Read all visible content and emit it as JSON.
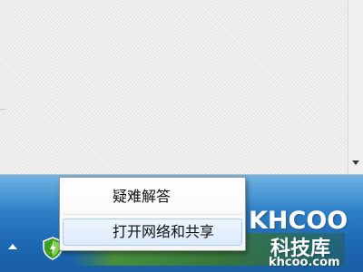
{
  "window": {
    "scroll_down_icon": "chevron-down-icon"
  },
  "taskbar": {
    "show_hidden_icon": "triangle-up-icon",
    "shield_icon": "shield-icon",
    "colors": {
      "top": "#4fa2dc",
      "bottom": "#1a5ea4",
      "shield": "#4caf2a"
    }
  },
  "context_menu": {
    "items": [
      {
        "label": "疑难解答"
      },
      {
        "label": "打开网络和共享"
      }
    ],
    "highlight_color": "#dbeafb"
  },
  "watermark": {
    "logo": "KHCOO",
    "name": "科技库",
    "url": "khcoo.com"
  }
}
